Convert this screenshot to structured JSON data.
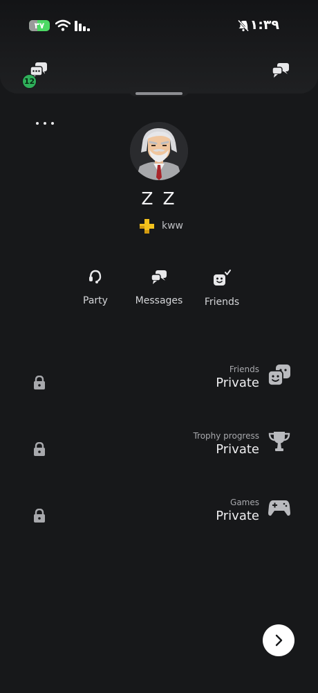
{
  "status_bar": {
    "battery": "۳۷",
    "time": "۱۱:۳۹"
  },
  "header": {
    "chat_badge_count": "12"
  },
  "profile": {
    "display_name": "Z Z",
    "online_id": "kww"
  },
  "actions": [
    {
      "label": "Party",
      "icon": "headset-icon"
    },
    {
      "label": "Messages",
      "icon": "chat-bubbles-icon"
    },
    {
      "label": "Friends",
      "icon": "friend-check-icon"
    }
  ],
  "privacy": [
    {
      "caption": "Friends",
      "value": "Private",
      "icon": "masks-icon"
    },
    {
      "caption": "Trophy progress",
      "value": "Private",
      "icon": "trophy-icon"
    },
    {
      "caption": "Games",
      "value": "Private",
      "icon": "controller-icon"
    }
  ],
  "colors": {
    "background": "#17181a",
    "badge": "#2fb05a",
    "battery": "#4cd964",
    "ps_plus": "#f4c21d",
    "icon_grey": "#b9babe"
  }
}
